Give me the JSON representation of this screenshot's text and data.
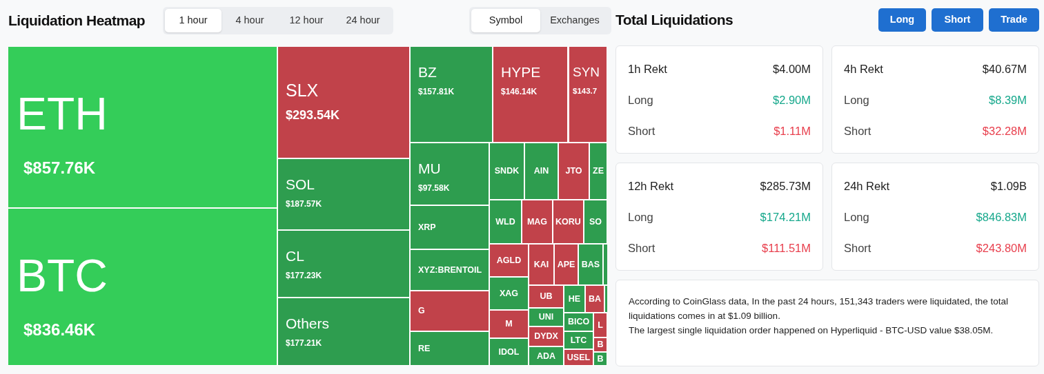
{
  "heatmap": {
    "title": "Liquidation Heatmap",
    "periods": [
      {
        "label": "1 hour",
        "selected": true
      },
      {
        "label": "4 hour",
        "selected": false
      },
      {
        "label": "12 hour",
        "selected": false
      },
      {
        "label": "24 hour",
        "selected": false
      }
    ],
    "views": [
      {
        "label": "Symbol",
        "selected": true
      },
      {
        "label": "Exchanges",
        "selected": false
      }
    ],
    "tiles": [
      {
        "symbol": "ETH",
        "value": "$857.76K",
        "color": "#34cd59"
      },
      {
        "symbol": "BTC",
        "value": "$836.46K",
        "color": "#34cd59"
      },
      {
        "symbol": "SLX",
        "value": "$293.54K",
        "color": "#c1424a"
      },
      {
        "symbol": "SOL",
        "value": "$187.57K",
        "color": "#2e9d4f"
      },
      {
        "symbol": "CL",
        "value": "$177.23K",
        "color": "#2e9d4f"
      },
      {
        "symbol": "Others",
        "value": "$177.21K",
        "color": "#2e9d4f"
      },
      {
        "symbol": "BZ",
        "value": "$157.81K",
        "color": "#2e9d4f"
      },
      {
        "symbol": "HYPE",
        "value": "$146.14K",
        "color": "#c1424a"
      },
      {
        "symbol": "SYN",
        "value": "$143.7",
        "color": "#c1424a"
      },
      {
        "symbol": "MU",
        "value": "$97.58K",
        "color": "#2e9d4f"
      },
      {
        "symbol": "XRP",
        "color": "#2e9d4f"
      },
      {
        "symbol": "XYZ:BRENTOIL",
        "color": "#2e9d4f"
      },
      {
        "symbol": "G",
        "color": "#c1424a"
      },
      {
        "symbol": "RE",
        "color": "#2e9d4f"
      },
      {
        "symbol": "SNDK",
        "color": "#2e9d4f"
      },
      {
        "symbol": "AIN",
        "color": "#2e9d4f"
      },
      {
        "symbol": "JTO",
        "color": "#c1424a"
      },
      {
        "symbol": "ZE",
        "color": "#2e9d4f"
      },
      {
        "symbol": "WLD",
        "color": "#2e9d4f"
      },
      {
        "symbol": "MAG",
        "color": "#c1424a"
      },
      {
        "symbol": "KORU",
        "color": "#c1424a"
      },
      {
        "symbol": "SO",
        "color": "#2e9d4f"
      },
      {
        "symbol": "AGLD",
        "color": "#c1424a"
      },
      {
        "symbol": "KAI",
        "color": "#c1424a"
      },
      {
        "symbol": "APE",
        "color": "#c1424a"
      },
      {
        "symbol": "BAS",
        "color": "#2e9d4f"
      },
      {
        "color": "#2e9d4f"
      },
      {
        "symbol": "XAG",
        "color": "#2e9d4f"
      },
      {
        "symbol": "M",
        "color": "#c1424a"
      },
      {
        "symbol": "IDOL",
        "color": "#2e9d4f"
      },
      {
        "symbol": "UB",
        "color": "#c1424a"
      },
      {
        "symbol": "UNI",
        "color": "#2e9d4f"
      },
      {
        "symbol": "DYDX",
        "color": "#c1424a"
      },
      {
        "symbol": "ADA",
        "color": "#2e9d4f"
      },
      {
        "symbol": "HE",
        "color": "#2e9d4f"
      },
      {
        "symbol": "BA",
        "color": "#c1424a"
      },
      {
        "color": "#2e9d4f"
      },
      {
        "symbol": "BICO",
        "color": "#2e9d4f"
      },
      {
        "symbol": "LTC",
        "color": "#2e9d4f"
      },
      {
        "symbol": "USEL",
        "color": "#c1424a"
      },
      {
        "symbol": "L",
        "color": "#c1424a"
      },
      {
        "symbol": "B",
        "color": "#c1424a"
      },
      {
        "symbol": "B",
        "color": "#2e9d4f"
      }
    ]
  },
  "totals": {
    "title": "Total Liquidations",
    "buttons": [
      "Long",
      "Short",
      "Trade"
    ],
    "cards": [
      {
        "rows": [
          {
            "kind": "total",
            "label": "1h Rekt",
            "value": "$4.00M"
          },
          {
            "kind": "long",
            "label": "Long",
            "value": "$2.90M"
          },
          {
            "kind": "short",
            "label": "Short",
            "value": "$1.11M"
          }
        ]
      },
      {
        "rows": [
          {
            "kind": "total",
            "label": "4h Rekt",
            "value": "$40.67M"
          },
          {
            "kind": "long",
            "label": "Long",
            "value": "$8.39M"
          },
          {
            "kind": "short",
            "label": "Short",
            "value": "$32.28M"
          }
        ]
      },
      {
        "rows": [
          {
            "kind": "total",
            "label": "12h Rekt",
            "value": "$285.73M"
          },
          {
            "kind": "long",
            "label": "Long",
            "value": "$174.21M"
          },
          {
            "kind": "short",
            "label": "Short",
            "value": "$111.51M"
          }
        ]
      },
      {
        "rows": [
          {
            "kind": "total",
            "label": "24h Rekt",
            "value": "$1.09B"
          },
          {
            "kind": "long",
            "label": "Long",
            "value": "$846.83M"
          },
          {
            "kind": "short",
            "label": "Short",
            "value": "$243.80M"
          }
        ]
      }
    ],
    "summary": [
      "According to CoinGlass data, In the past 24 hours, 151,343 traders were liquidated, the total liquidations comes in at $1.09 billion.",
      "The largest single liquidation order happened on Hyperliquid - BTC-USD value $38.05M."
    ]
  }
}
